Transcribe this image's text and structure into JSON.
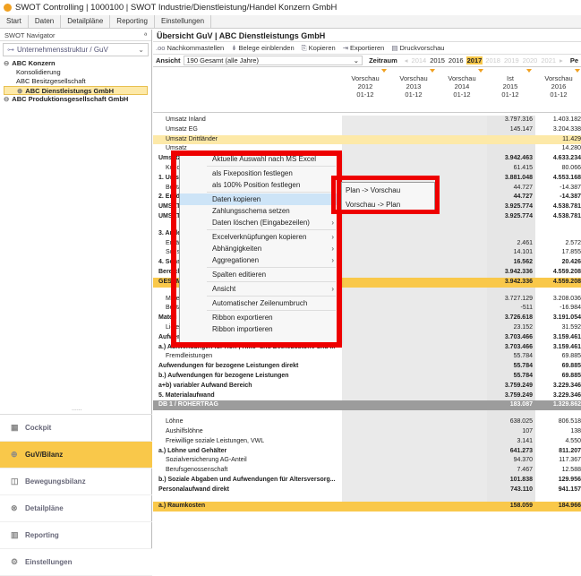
{
  "window": {
    "title": "SWOT Controlling | 1000100 | SWOT Industrie/Dienstleistung/Handel Konzern GmbH"
  },
  "menubar": {
    "items": [
      "Start",
      "Daten",
      "Detailpläne",
      "Reporting",
      "Einstellungen"
    ]
  },
  "sidebar": {
    "header": "SWOT Navigator",
    "pin": "ª",
    "select": "Unternehmensstruktur / GuV",
    "tree": [
      {
        "label": "ABC Konzern",
        "level": 0,
        "prefix": "⊖"
      },
      {
        "label": "Konsolidierung",
        "level": 1
      },
      {
        "label": "ABC Besitzgesellschaft",
        "level": 1
      },
      {
        "label": "ABC Dienstleistungs GmbH",
        "level": 1,
        "selected": true,
        "prefix": "⊕"
      },
      {
        "label": "ABC Produktionsgesellschaft GmbH",
        "level": 0,
        "prefix": "⊖"
      }
    ],
    "dots": "......",
    "nav": [
      {
        "label": "Cockpit",
        "icon": "▦"
      },
      {
        "label": "GuV/Bilanz",
        "icon": "⊕",
        "active": true
      },
      {
        "label": "Bewegungsbilanz",
        "icon": "◫"
      },
      {
        "label": "Detailpläne",
        "icon": "⊗"
      },
      {
        "label": "Reporting",
        "icon": "▥"
      },
      {
        "label": "Einstellungen",
        "icon": "⚙"
      }
    ]
  },
  "main": {
    "title": "Übersicht GuV | ABC Dienstleistungs GmbH",
    "toolbar": [
      "Nachkommastellen",
      "Belege einblenden",
      "Kopieren",
      "Exportieren",
      "Druckvorschau"
    ],
    "filter": {
      "ansicht_label": "Ansicht",
      "ansicht_value": "190 Gesamt (alle Jahre)",
      "zeitraum_label": "Zeitraum",
      "years": [
        "2014",
        "2015",
        "2016",
        "2017",
        "2018",
        "2019",
        "2020",
        "2021"
      ],
      "selected_year": "2017",
      "active_years": [
        "2015",
        "2016",
        "2017"
      ],
      "pe": "Pe"
    },
    "columns": [
      {
        "l1": "Vorschau",
        "l2": "2012",
        "l3": "01-12"
      },
      {
        "l1": "Vorschau",
        "l2": "2013",
        "l3": "01-12"
      },
      {
        "l1": "Vorschau",
        "l2": "2014",
        "l3": "01-12"
      },
      {
        "l1": "Ist",
        "l2": "2015",
        "l3": "01-12"
      },
      {
        "l1": "Vorschau",
        "l2": "2016",
        "l3": "01-12"
      }
    ],
    "rows": [
      {
        "label": "Umsatz Inland",
        "style": "sub",
        "v3": "3.797.316",
        "v4": "1.403.182"
      },
      {
        "label": "Umsatz EG",
        "style": "sub",
        "v3": "145.147",
        "v4": "3.204.338"
      },
      {
        "label": "Umsatz Drittländer",
        "style": "sub lightorange",
        "v3": "",
        "v4": "11.429"
      },
      {
        "label": "Umsatz",
        "style": "sub",
        "v3": "",
        "v4": "14.280"
      },
      {
        "label": "Umsatz",
        "style": "bold",
        "v3": "3.942.463",
        "v4": "4.633.234"
      },
      {
        "label": "Kund",
        "style": "sub",
        "v3": "61.415",
        "v4": "80.066"
      },
      {
        "label": "1. Umsatz",
        "style": "bold",
        "v3": "3.881.048",
        "v4": "4.553.168"
      },
      {
        "label": "Besta",
        "style": "sub",
        "v3": "44.727",
        "v4": "-14.387"
      },
      {
        "label": "2. Erhöhung",
        "style": "bold",
        "v3": "44.727",
        "v4": "-14.387"
      },
      {
        "label": "UMSATZ",
        "style": "bold",
        "v3": "3.925.774",
        "v4": "4.538.781"
      },
      {
        "label": "UMSATZ",
        "style": "bold",
        "v3": "3.925.774",
        "v4": "4.538.781"
      },
      {
        "label": "",
        "style": "blank",
        "v3": "",
        "v4": ""
      },
      {
        "label": "3. Andere",
        "style": "bold",
        "v3": "",
        "v4": ""
      },
      {
        "label": "Erträ",
        "style": "sub",
        "v3": "2.461",
        "v4": "2.572"
      },
      {
        "label": "Sonst",
        "style": "sub",
        "v3": "14.101",
        "v4": "17.855"
      },
      {
        "label": "4. Sonstig",
        "style": "bold",
        "v3": "16.562",
        "v4": "20.426"
      },
      {
        "label": "Bereich",
        "style": "bold",
        "v3": "3.942.336",
        "v4": "4.559.208"
      },
      {
        "label": "GESAMTL",
        "style": "orange",
        "v3": "3.942.336",
        "v4": "4.559.208"
      },
      {
        "label": "",
        "style": "blank",
        "v3": "",
        "v4": ""
      },
      {
        "label": "Mate",
        "style": "sub",
        "v3": "3.727.129",
        "v4": "3.208.036"
      },
      {
        "label": "Besta",
        "style": "sub",
        "v3": "-511",
        "v4": "-16.984"
      },
      {
        "label": "Materi",
        "style": "bold",
        "v3": "3.726.618",
        "v4": "3.191.054"
      },
      {
        "label": "Lieferskonti",
        "style": "sub",
        "v3": "23.152",
        "v4": "31.592"
      },
      {
        "label": "Aufwendungen für Roh-, Hilfs- und Betriebsstoffe und f...",
        "style": "bold",
        "v3": "3.703.466",
        "v4": "3.159.461"
      },
      {
        "label": "a.) Aufwendungen für Roh-, Hilfs- und Betriebsstoffe und ...",
        "style": "bold",
        "v3": "3.703.466",
        "v4": "3.159.461"
      },
      {
        "label": "Fremdleistungen",
        "style": "sub",
        "v3": "55.784",
        "v4": "69.885"
      },
      {
        "label": "Aufwendungen für bezogene Leistungen direkt",
        "style": "bold",
        "v3": "55.784",
        "v4": "69.885"
      },
      {
        "label": "b.) Aufwendungen für bezogene Leistungen",
        "style": "bold",
        "v3": "55.784",
        "v4": "69.885"
      },
      {
        "label": "a+b) variabler Aufwand Bereich",
        "style": "bold",
        "v3": "3.759.249",
        "v4": "3.229.346"
      },
      {
        "label": "5. Materialaufwand",
        "style": "bold",
        "v3": "3.759.249",
        "v4": "3.229.346"
      },
      {
        "label": "DB 1 / ROHERTRAG",
        "style": "gray",
        "v3": "183.087",
        "v4": "1.329.862"
      },
      {
        "label": "",
        "style": "blank",
        "v3": "",
        "v4": ""
      },
      {
        "label": "Löhne",
        "style": "sub",
        "v3": "638.025",
        "v4": "806.518"
      },
      {
        "label": "Aushilfslöhne",
        "style": "sub",
        "v3": "107",
        "v4": "138"
      },
      {
        "label": "Freiwillige soziale Leistungen, VWL",
        "style": "sub",
        "v3": "3.141",
        "v4": "4.550"
      },
      {
        "label": "a.) Löhne und Gehälter",
        "style": "bold",
        "v3": "641.273",
        "v4": "811.207"
      },
      {
        "label": "Sozialversicherung AG-Anteil",
        "style": "sub",
        "v3": "94.370",
        "v4": "117.367"
      },
      {
        "label": "Berufsgenossenschaft",
        "style": "sub",
        "v3": "7.467",
        "v4": "12.588"
      },
      {
        "label": "b.) Soziale Abgaben und Aufwendungen für Altersversorg...",
        "style": "bold",
        "v3": "101.838",
        "v4": "129.956"
      },
      {
        "label": "Personalaufwand direkt",
        "style": "bold",
        "v3": "743.110",
        "v4": "941.157"
      },
      {
        "label": "",
        "style": "blank",
        "v3": "",
        "v4": ""
      },
      {
        "label": "a.) Raumkosten",
        "style": "orange",
        "v3": "158.059",
        "v4": "184.966"
      }
    ]
  },
  "context_menu": {
    "items": [
      {
        "label": "Aktuelle Auswahl nach MS Excel",
        "arrow": false
      },
      {
        "sep": true
      },
      {
        "label": "als Fixeposition festlegen",
        "arrow": false
      },
      {
        "label": "als 100% Position festlegen",
        "arrow": false
      },
      {
        "sep": true
      },
      {
        "label": "Daten kopieren",
        "arrow": true,
        "highlight": true
      },
      {
        "label": "Zahlungsschema setzen",
        "arrow": true
      },
      {
        "label": "Daten löschen (Eingabezeilen)",
        "arrow": true
      },
      {
        "sep": true
      },
      {
        "label": "Excelverknüpfungen kopieren",
        "arrow": true
      },
      {
        "label": "Abhängigkeiten",
        "arrow": true
      },
      {
        "label": "Aggregationen",
        "arrow": true
      },
      {
        "sep": true
      },
      {
        "label": "Spalten editieren",
        "arrow": false
      },
      {
        "sep": true
      },
      {
        "label": "Ansicht",
        "arrow": true
      },
      {
        "sep": true
      },
      {
        "label": "Automatischer Zeilenumbruch",
        "arrow": false
      },
      {
        "sep": true
      },
      {
        "label": "Ribbon exportieren",
        "arrow": false
      },
      {
        "label": "Ribbon importieren",
        "arrow": false
      }
    ],
    "submenu": [
      "Plan -> Vorschau",
      "Vorschau -> Plan"
    ]
  },
  "colors": {
    "accent": "#f9c84a",
    "highlight_red": "#e00000",
    "gray_row": "#9c9c9c"
  }
}
